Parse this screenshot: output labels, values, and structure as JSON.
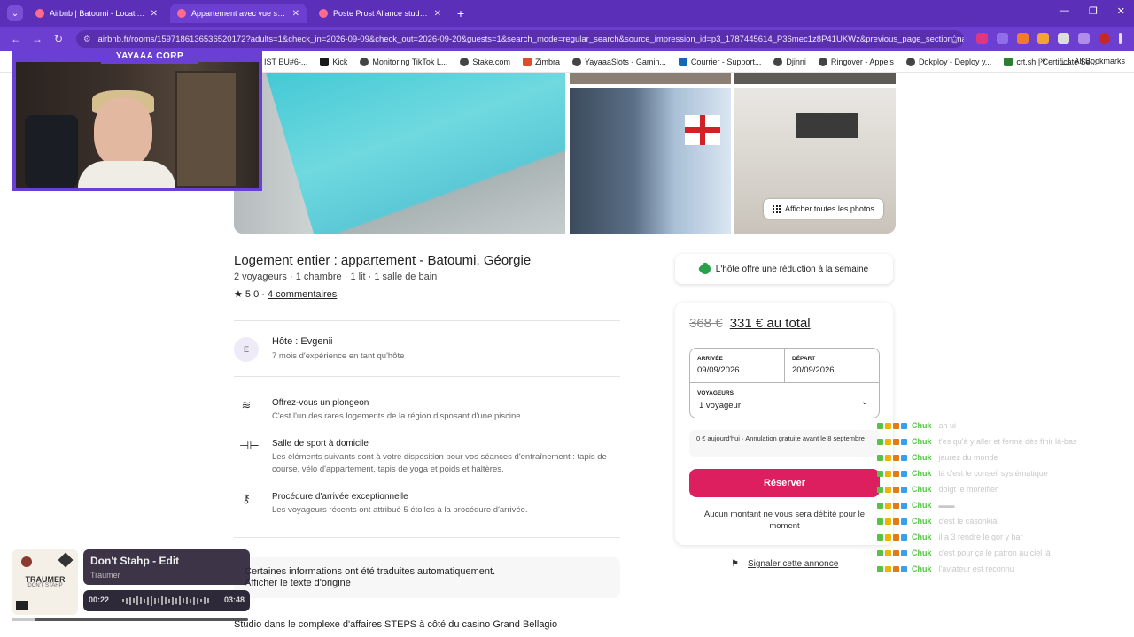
{
  "browser": {
    "tabs": [
      {
        "title": "Airbnb | Batoumi - Locations de vacances"
      },
      {
        "title": "Appartement avec vue sur la mer"
      },
      {
        "title": "Poste Prost Aliance studio 123"
      }
    ],
    "url": "airbnb.fr/rooms/1597186136536520172?adults=1&check_in=2026-09-09&check_out=2026-09-20&guests=1&search_mode=regular_search&source_impression_id=p3_1787445614_P36mec1z8P41UKWz&previous_page_section_na...",
    "bookmarks": [
      "IST EU#6-...",
      "Kick",
      "Monitoring TikTok L...",
      "Stake.com",
      "Zimbra",
      "YayaaaSlots - Gamin...",
      "Courrier - Support...",
      "Djinni",
      "Ringover - Appels",
      "Dokploy - Deploy y...",
      "crt.sh | Certificate Se..."
    ],
    "all_bookmarks": "All Bookmarks"
  },
  "listing": {
    "title": "Logement entier : appartement - Batoumi, Géorgie",
    "subtitle": "2 voyageurs · 1 chambre · 1 lit · 1 salle de bain",
    "rating": "★ 5,0 ·",
    "reviews": "4 commentaires",
    "show_all_photos": "Afficher toutes les photos",
    "host": {
      "initial": "E",
      "name": "Hôte : Evgenii",
      "experience": "7 mois d'expérience en tant qu'hôte"
    },
    "features": [
      {
        "title": "Offrez-vous un plongeon",
        "desc": "C'est l'un des rares logements de la région disposant d'une piscine."
      },
      {
        "title": "Salle de sport à domicile",
        "desc": "Les éléments suivants sont à votre disposition pour vos séances d'entraînement : tapis de course, vélo d'appartement, tapis de yoga et poids et haltères."
      },
      {
        "title": "Procédure d'arrivée exceptionnelle",
        "desc": "Les voyageurs récents ont attribué 5 étoiles à la procédure d'arrivée."
      }
    ],
    "translation_note": "Certaines informations ont été traduites automatiquement.",
    "translation_link": "Afficher le texte d'origine",
    "description": "Studio dans le complexe d'affaires STEPS à côté du casino Grand Bellagio"
  },
  "booking": {
    "discount": "L'hôte offre une réduction à la semaine",
    "old_price": "368 €",
    "total": "331 € au total",
    "checkin_label": "ARRIVÉE",
    "checkin": "09/09/2026",
    "checkout_label": "DÉPART",
    "checkout": "20/09/2026",
    "guests_label": "VOYAGEURS",
    "guests": "1 voyageur",
    "cancellation": "0 € aujourd'hui · Annulation gratuite avant le 8 septembre",
    "reserve": "Réserver",
    "no_charge": "Aucun montant ne vous sera débité pour le moment",
    "report": "Signaler cette annonce"
  },
  "stream": {
    "cam_label": "YAYAAA CORP",
    "chat": [
      {
        "user": "Chuk",
        "msg": "ah ui"
      },
      {
        "user": "Chuk",
        "msg": "t'es qu'à y aller et fermé dès finir là-bas"
      },
      {
        "user": "Chuk",
        "msg": "jaurez du monde"
      },
      {
        "user": "Chuk",
        "msg": "là c'est le conseil systématique"
      },
      {
        "user": "Chuk",
        "msg": "doigt le morelfier"
      },
      {
        "user": "Chuk",
        "msg": "▬▬"
      },
      {
        "user": "Chuk",
        "msg": "c'est le casonkial"
      },
      {
        "user": "Chuk",
        "msg": "il a 3 rendre le gor y bar"
      },
      {
        "user": "Chuk",
        "msg": "c'est pour ça le patron au ciel là"
      },
      {
        "user": "Chuk",
        "msg": "l'aviateur est reconnu"
      }
    ],
    "music": {
      "album_artist": "TRAUMER",
      "album_sub": "DON'T STAHP",
      "title": "Don't Stahp - Edit",
      "artist": "Traumer",
      "current": "00:22",
      "total": "03:48",
      "progress": 0.096
    }
  }
}
